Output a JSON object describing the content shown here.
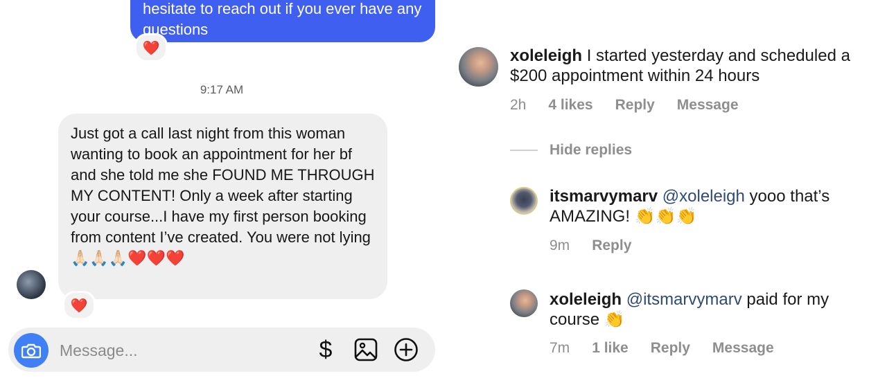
{
  "dm": {
    "outgoing_message": "hesitate to reach out if you ever have any questions",
    "outgoing_reaction": "❤️",
    "timestamp": "9:17 AM",
    "incoming_message": "Just got a call last night from this woman wanting to book an appointment for her bf and she told me she FOUND ME THROUGH MY CONTENT! Only a week after starting your course...I have my first person booking from content I’ve created. You were not lying 🙏🏻🙏🏻🙏🏻❤️❤️❤️",
    "incoming_reaction": "❤️",
    "composer": {
      "placeholder": "Message...",
      "dollar_icon_glyph": "$"
    },
    "icons": [
      "camera-icon",
      "dollar-icon",
      "image-icon",
      "plus-circle-icon"
    ]
  },
  "comments": {
    "c1": {
      "username": "xoleleigh",
      "text": " I started yesterday and scheduled a $200 appointment within 24 hours",
      "time": "2h",
      "likes": "4 likes",
      "reply": "Reply",
      "message": "Message"
    },
    "hide_replies": "Hide replies",
    "c2": {
      "username": "itsmarvymarv",
      "mention": "@xoleleigh",
      "text": " yooo that’s AMAZING! 👏👏👏",
      "time": "9m",
      "reply": "Reply"
    },
    "c3": {
      "username": "xoleleigh",
      "mention": "@itsmarvymarv",
      "text": " paid for my course 👏",
      "time": "7m",
      "likes": "1 like",
      "reply": "Reply",
      "message": "Message"
    }
  },
  "colors": {
    "outgoing_bubble": "#3f5ff1",
    "incoming_bubble": "#efefef",
    "camera_button": "#3f80f5",
    "mention": "#2e4a77",
    "meta_gray": "#8e8e8e"
  }
}
